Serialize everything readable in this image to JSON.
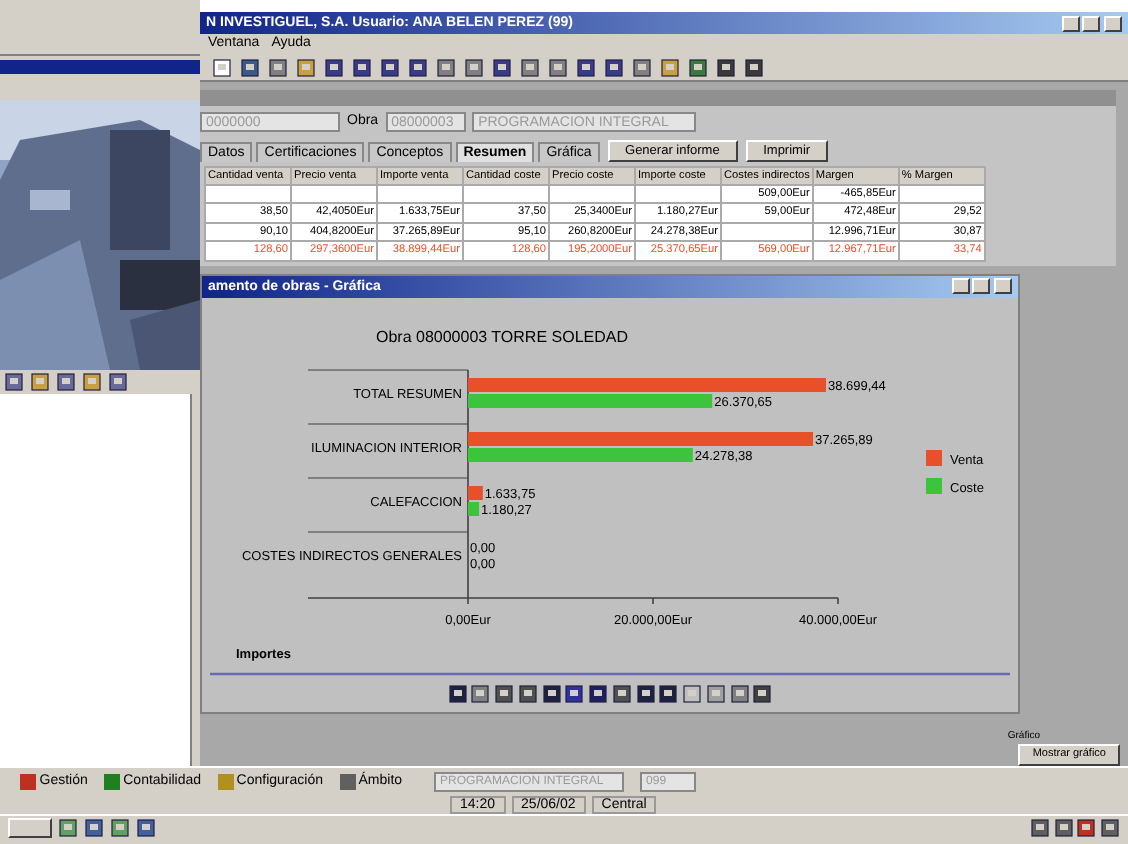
{
  "main_window": {
    "title": "N INVESTIGUEL, S.A. Usuario: ANA BELEN PEREZ (99)",
    "menu": [
      "Ventana",
      "Ayuda"
    ]
  },
  "work_form": {
    "fields": [
      {
        "value": "0000000"
      },
      {
        "label": "Obra",
        "value": "08000003"
      },
      {
        "value": "PROGRAMACION INTEGRAL"
      }
    ],
    "tabs": [
      {
        "label": "Datos",
        "selected": false
      },
      {
        "label": "Certificaciones",
        "selected": false
      },
      {
        "label": "Conceptos",
        "selected": false
      },
      {
        "label": "Resumen",
        "selected": true
      },
      {
        "label": "Gráfica",
        "selected": false
      }
    ],
    "buttons": [
      "Generar informe",
      "Imprimir"
    ],
    "table": {
      "columns": [
        "Cantidad venta",
        "Precio venta",
        "Importe venta",
        "Cantidad coste",
        "Precio coste",
        "Importe coste",
        "Costes indirectos",
        "Margen",
        "% Margen"
      ],
      "rows": [
        {
          "total": false,
          "cells": [
            "",
            "",
            "",
            "",
            "",
            "",
            "509,00Eur",
            "-465,85Eur",
            ""
          ]
        },
        {
          "total": false,
          "cells": [
            "38,50",
            "42,4050Eur",
            "1.633,75Eur",
            "37,50",
            "25,3400Eur",
            "1.180,27Eur",
            "59,00Eur",
            "472,48Eur",
            "29,52"
          ]
        },
        {
          "total": false,
          "cells": [
            "90,10",
            "404,8200Eur",
            "37.265,89Eur",
            "95,10",
            "260,8200Eur",
            "24.278,38Eur",
            "",
            "12.996,71Eur",
            "30,87"
          ]
        },
        {
          "total": true,
          "cells": [
            "128,60",
            "297,3600Eur",
            "38.899,44Eur",
            "128,60",
            "195,2000Eur",
            "25.370,65Eur",
            "569,00Eur",
            "12.967,71Eur",
            "33,74"
          ]
        }
      ]
    }
  },
  "chart_window": {
    "title": "amento de obras - Gráfica",
    "chart_data": {
      "type": "bar",
      "orientation": "horizontal",
      "title": "Obra 08000003 TORRE SOLEDAD",
      "xlabel": "Importes",
      "categories": [
        "TOTAL RESUMEN",
        "ILUMINACION INTERIOR",
        "CALEFACCION",
        "COSTES INDIRECTOS GENERALES"
      ],
      "xlim": [
        0,
        40000
      ],
      "xticks": [
        {
          "value": 0,
          "label": "0,00Eur"
        },
        {
          "value": 20000,
          "label": "20.000,00Eur"
        },
        {
          "value": 40000,
          "label": "40.000,00Eur"
        }
      ],
      "legend": true,
      "series": [
        {
          "name": "Venta",
          "color": "#e8502a",
          "values": [
            38700,
            37300,
            1600,
            0
          ]
        },
        {
          "name": "Coste",
          "color": "#3cc43c",
          "values": [
            26400,
            24300,
            1200,
            0
          ]
        }
      ],
      "value_labels": [
        [
          "38.699,44",
          "37.265,89",
          "1.633,75",
          "0,00"
        ],
        [
          "26.370,65",
          "24.278,38",
          "1.180,27",
          "0,00"
        ]
      ]
    }
  },
  "side_panel": {
    "caption": "Gráfico",
    "button": "Mostrar gráfico"
  },
  "bottom_bar": {
    "modules": [
      "Gestión",
      "Contabilidad",
      "Configuración",
      "Ámbito"
    ],
    "combo": "PROGRAMACION INTEGRAL",
    "combo_2": "099"
  },
  "status_bar": [
    "14:20",
    "25/06/02",
    "Central"
  ]
}
